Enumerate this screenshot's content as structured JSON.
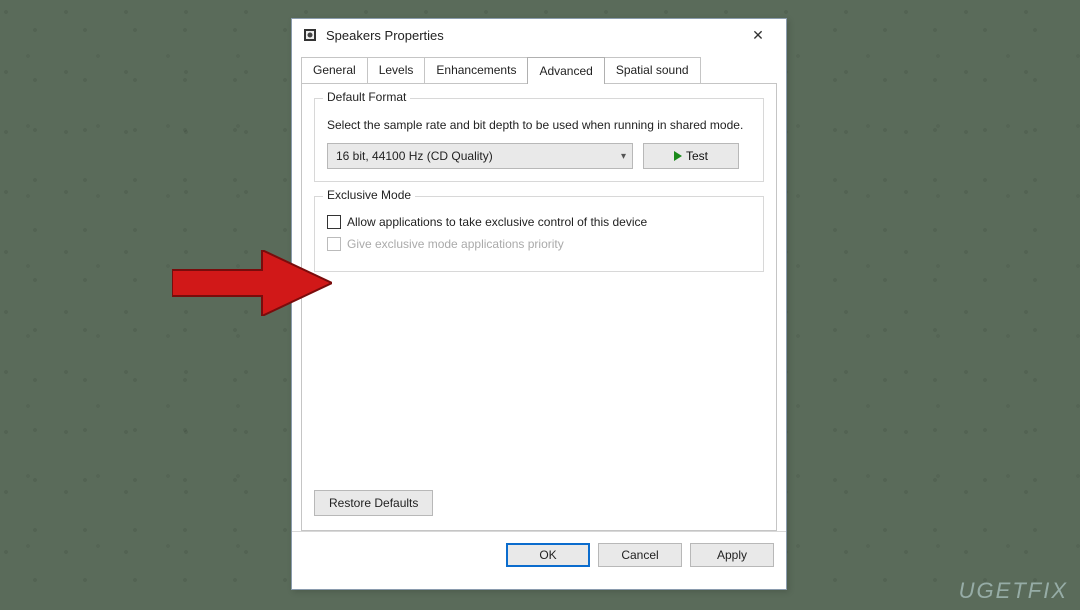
{
  "window": {
    "title": "Speakers Properties"
  },
  "tabs": {
    "items": [
      "General",
      "Levels",
      "Enhancements",
      "Advanced",
      "Spatial sound"
    ],
    "active_index": 3
  },
  "default_format": {
    "group_title": "Default Format",
    "description": "Select the sample rate and bit depth to be used when running in shared mode.",
    "selected": "16 bit, 44100 Hz (CD Quality)",
    "test_label": "Test"
  },
  "exclusive_mode": {
    "group_title": "Exclusive Mode",
    "opt1": {
      "label": "Allow applications to take exclusive control of this device",
      "checked": false,
      "enabled": true
    },
    "opt2": {
      "label": "Give exclusive mode applications priority",
      "checked": false,
      "enabled": false
    }
  },
  "restore_label": "Restore Defaults",
  "footer": {
    "ok": "OK",
    "cancel": "Cancel",
    "apply": "Apply"
  },
  "watermark": "UGETFIX"
}
